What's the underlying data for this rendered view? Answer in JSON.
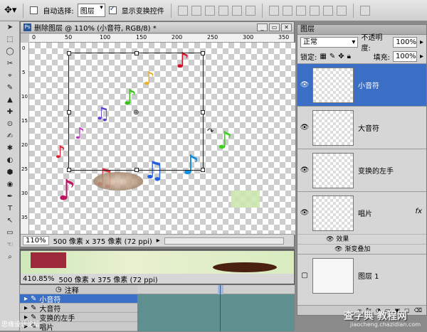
{
  "options_bar": {
    "auto_select_label": "自动选择:",
    "auto_select_value": "图层",
    "show_transform_label": "显示变换控件"
  },
  "tools": [
    "➤",
    "⬚",
    "◯",
    "✂",
    "⌖",
    "✎",
    "▲",
    "✚",
    "⊙",
    "✍",
    "✱",
    "◐",
    "⬢",
    "◉",
    "✒",
    "T",
    "↖",
    "▭",
    "☜",
    "⌕"
  ],
  "document": {
    "title": "删除图层 @ 110% (小音符, RGB/8) *",
    "ruler_h": [
      "0",
      "50",
      "100",
      "150",
      "200",
      "250",
      "300",
      "350"
    ],
    "ruler_v": [
      "0",
      "5",
      "10",
      "15",
      "20",
      "25",
      "30",
      "35"
    ],
    "zoom": "110%",
    "doc_info": "500 像素 x 375 像素 (72 ppi)"
  },
  "document2": {
    "zoom": "410.85%",
    "doc_info": "500 像素 x 375 像素 (72 ppi)"
  },
  "timeline": {
    "rows": [
      {
        "label": "注释",
        "selected": false
      },
      {
        "label": "小音符",
        "selected": true
      },
      {
        "label": "大音符",
        "selected": false
      },
      {
        "label": "变换的左手",
        "selected": false
      },
      {
        "label": "唱片",
        "selected": false
      }
    ]
  },
  "layers_panel": {
    "tab": "图层",
    "blend_mode": "正常",
    "opacity_label": "不透明度:",
    "opacity_value": "100%",
    "lock_label": "锁定:",
    "fill_label": "填充:",
    "fill_value": "100%",
    "layers": [
      {
        "name": "小音符",
        "active": true,
        "fx": false
      },
      {
        "name": "大音符",
        "active": false,
        "fx": false
      },
      {
        "name": "变换的左手",
        "active": false,
        "fx": false
      },
      {
        "name": "唱片",
        "active": false,
        "fx": true
      }
    ],
    "fx_symbol": "fx",
    "effects_label": "效果",
    "effect_item": "渐变叠加",
    "background_layer": "图层 1",
    "bottom_icons": [
      "∞",
      "fx",
      "◑",
      "▭",
      "▣",
      "▢",
      "⌫"
    ]
  },
  "watermark": {
    "site_title": "查字典 教程网",
    "site_url": "jiaocheng.chazidian.com",
    "forum": "思缘设计论坛"
  },
  "colors": {
    "accent": "#3b6fc6"
  }
}
